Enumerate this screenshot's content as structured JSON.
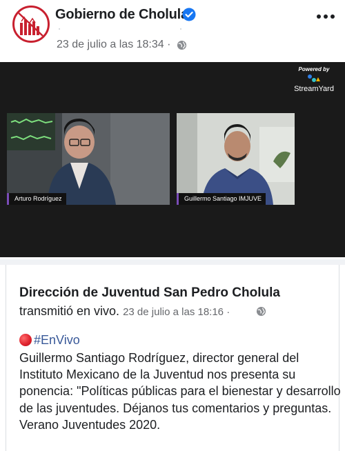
{
  "post": {
    "page_name": "Gobierno de Cholula",
    "timestamp": "23 de julio a las 18:34 ·",
    "more_label": "•••"
  },
  "video": {
    "powered_by": "Powered by",
    "brand": "StreamYard",
    "participants": [
      {
        "name": "Arturo Rodríguez"
      },
      {
        "name": "Guillermo Santiago IMJUVE"
      }
    ]
  },
  "shared": {
    "page_name": "Dirección de Juventud San Pedro Cholula",
    "action": "transmitió en vivo.",
    "timestamp": "23 de julio a las 18:16 ·",
    "hashtag": "#EnVivo",
    "body": "Guillermo Santiago Rodríguez, director general del Instituto Mexicano de la Juventud nos presenta su ponencia: \"Políticas públicas para el bienestar y desarrollo de las juventudes. Déjanos tus comentarios y preguntas. Verano Juventudes 2020."
  },
  "colors": {
    "accent_red": "#c8202f",
    "verified_blue": "#1877f2",
    "hashtag_blue": "#385898",
    "meta_gray": "#65676b"
  }
}
